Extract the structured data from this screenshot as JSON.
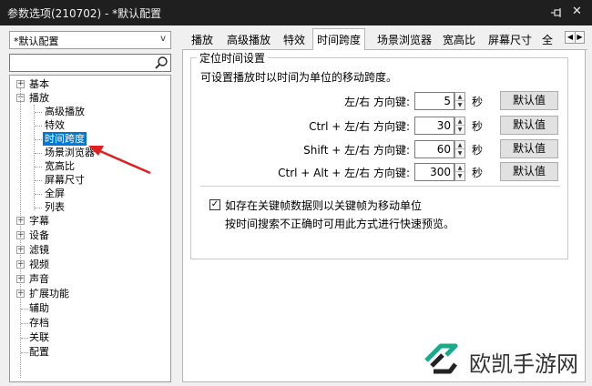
{
  "window": {
    "title": "参数选项(210702) - *默认配置"
  },
  "sidebar": {
    "preset_value": "*默认配置",
    "search_value": "",
    "tree": {
      "basic": "基本",
      "playback": "播放",
      "playback_children": [
        "高级播放",
        "特效",
        "时间跨度",
        "场景浏览器",
        "宽高比",
        "屏幕尺寸",
        "全屏",
        "列表"
      ],
      "others": [
        "字幕",
        "设备",
        "滤镜",
        "视频",
        "声音",
        "扩展功能"
      ],
      "leaves": [
        "辅助",
        "存档",
        "关联",
        "配置"
      ],
      "selected": "时间跨度"
    }
  },
  "tabs": [
    "播放",
    "高级播放",
    "特效",
    "时间跨度",
    "场景浏览器",
    "宽高比",
    "屏幕尺寸",
    "全"
  ],
  "active_tab": "时间跨度",
  "panel": {
    "group_title": "定位时间设置",
    "description": "可设置播放时以时间为单位的移动跨度。",
    "rows": [
      {
        "label": "左/右 方向键:",
        "value": "5",
        "unit": "秒",
        "button": "默认值"
      },
      {
        "label": "Ctrl + 左/右 方向键:",
        "value": "30",
        "unit": "秒",
        "button": "默认值"
      },
      {
        "label": "Shift + 左/右 方向键:",
        "value": "60",
        "unit": "秒",
        "button": "默认值"
      },
      {
        "label": "Ctrl + Alt + 左/右 方向键:",
        "value": "300",
        "unit": "秒",
        "button": "默认值"
      }
    ],
    "keyframe_checkbox": {
      "label": "如存在关键帧数据则以关键帧为移动单位",
      "checked": true
    },
    "hint": "按时间搜索不正确时可用此方式进行快速预览。"
  },
  "watermark": {
    "text": "欧凯手游网"
  },
  "colors": {
    "selection": "#0078d7",
    "titlebar": "#1f1f1f",
    "arrow": "#e02020",
    "logo": "#1aaa8a"
  }
}
